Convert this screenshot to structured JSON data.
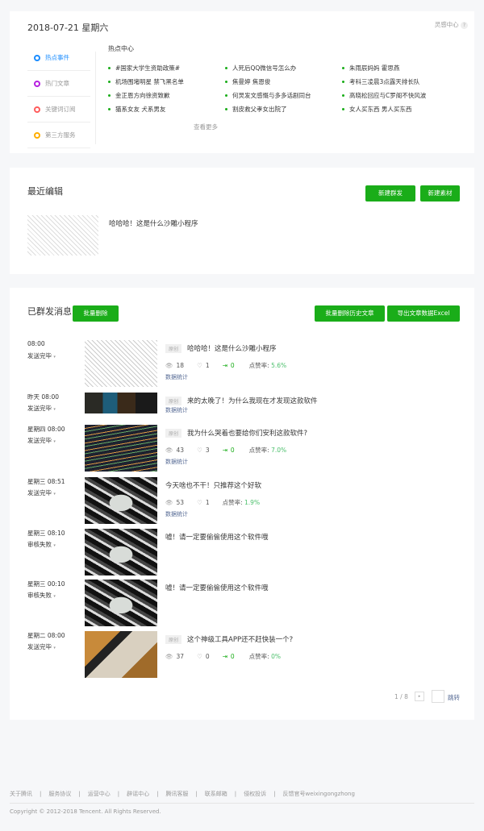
{
  "header": {
    "date": "2018-07-21 星期六",
    "inspiration": "灵感中心",
    "help_icon": "question-circle-icon"
  },
  "side_tabs": [
    {
      "label": "热点事件",
      "color": "#1a8cff",
      "active": true
    },
    {
      "label": "热门文章",
      "color": "#b620e0"
    },
    {
      "label": "关键词订阅",
      "color": "#ff5c5c"
    },
    {
      "label": "第三方服务",
      "color": "#ffae00"
    }
  ],
  "hot": {
    "title": "热点中心",
    "items": [
      "#国家大学生资助政策#",
      "人死后QQ微信号怎么办",
      "朱雨辰妈妈 霍思燕",
      "机场围堵明星 禁飞黑名单",
      "焦曼婷 焦恩俊",
      "考科三凌晨3点露天排长队",
      "金正恩方向徐资致歉",
      "何炅发文感慨与多多话剧同台",
      "高晓松回应与C罗阁不快风波",
      "猫系女友 犬系男友",
      "割皮救父孝女出院了",
      "女人买东西 男人买东西"
    ],
    "more": "查看更多"
  },
  "recent": {
    "title": "最近编辑",
    "new_mass": "新建群发",
    "new_material": "新建素材",
    "item_title": "哈哈哈！这是什么沙雕小程序"
  },
  "sent": {
    "title": "已群发消息",
    "batch_delete": "批量删除",
    "batch_delete_history": "批量删除历史文章",
    "export": "导出文章数据Excel",
    "tag": "原创",
    "stat_link": "数据统计",
    "rate_label": "点赞率: ",
    "rows": [
      {
        "time": "08:00",
        "status": "发送完毕",
        "title": "哈哈哈！这是什么沙雕小程序",
        "original": true,
        "views": "18",
        "likes": "1",
        "shares": "0",
        "rate": "5.6%",
        "stats": true,
        "thumb": "pattern"
      },
      {
        "time": "昨天 08:00",
        "status": "发送完毕",
        "title": "来的太晚了！为什么我现在才发现这款软件",
        "original": true,
        "stats": false,
        "thumb": "studio"
      },
      {
        "time": "星期四 08:00",
        "status": "发送完毕",
        "title": "我为什么哭着也要给你们安利这款软件?",
        "original": true,
        "views": "43",
        "likes": "3",
        "shares": "0",
        "rate": "7.0%",
        "stats": true,
        "thumb": "code"
      },
      {
        "time": "星期三 08:51",
        "status": "发送完毕",
        "title": "今天啥也不干！只推荐这个好软",
        "original": false,
        "views": "53",
        "likes": "1",
        "rate": "1.9%",
        "stats": true,
        "thumb": "phone"
      },
      {
        "time": "星期三 08:10",
        "status": "审核失败",
        "title": "嘘！请一定要偷偷使用这个软件哦",
        "original": false,
        "stats": false,
        "thumb": "phone"
      },
      {
        "time": "星期三 00:10",
        "status": "审核失败",
        "title": "嘘！请一定要偷偷使用这个软件哦",
        "original": false,
        "stats": false,
        "thumb": "phone"
      },
      {
        "time": "星期二 08:00",
        "status": "发送完毕",
        "title": "这个神级工具APP还不赶快装一个?",
        "original": true,
        "views": "37",
        "likes": "0",
        "shares": "0",
        "rate": "0%",
        "stats": false,
        "thumb": "tools"
      }
    ],
    "pagination": {
      "page": "1 / 8",
      "jump": "跳转"
    }
  },
  "footer": {
    "links": [
      "关于腾讯",
      "服务协议",
      "运营中心",
      "辟谣中心",
      "腾讯客服",
      "联系邮箱",
      "侵权投诉",
      "反馈官号weixingongzhong"
    ],
    "copyright": "Copyright © 2012-2018 Tencent. All Rights Reserved."
  }
}
